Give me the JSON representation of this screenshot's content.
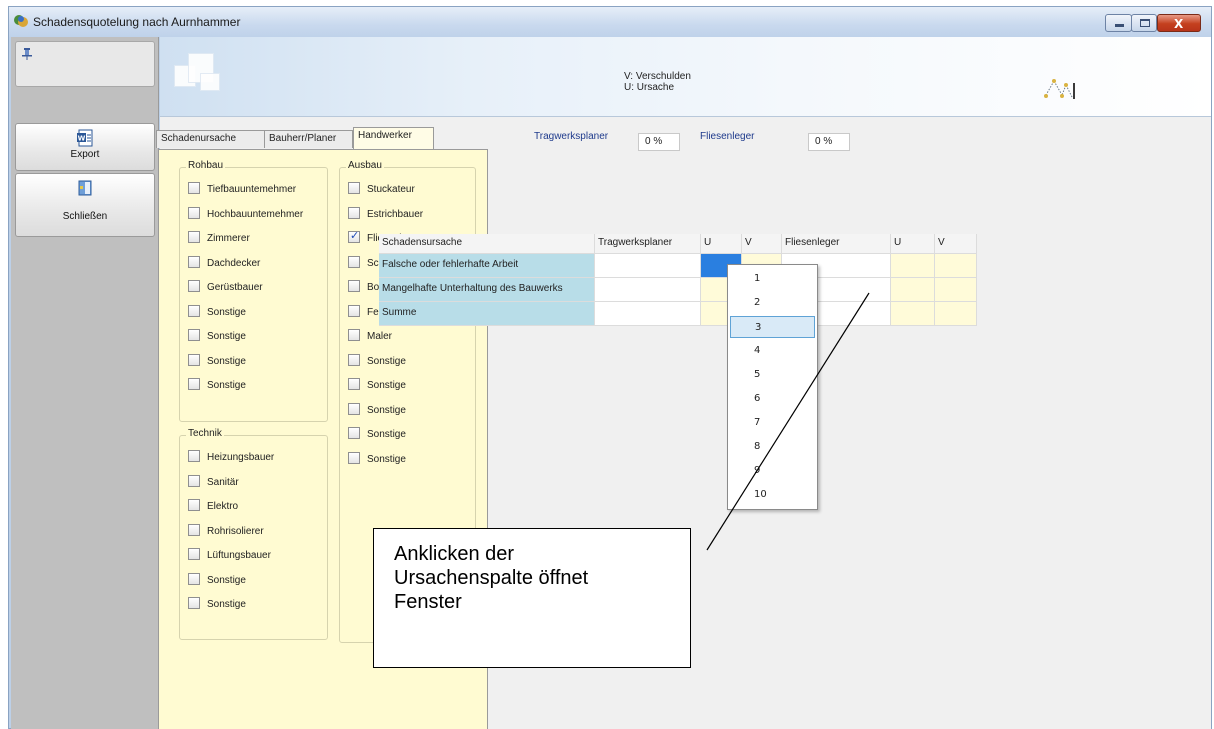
{
  "window": {
    "title": "Schadensquotelung nach Aurnhammer",
    "close_glyph": "X"
  },
  "sidebar": {
    "pin_icon": "pin-icon",
    "export_label": "Export",
    "close_label": "Schließen"
  },
  "banner": {
    "line1": "V: Verschulden",
    "line2": "U: Ursache"
  },
  "tabs": [
    {
      "label": "Schadenursache",
      "active": false
    },
    {
      "label": "Bauherr/Planer",
      "active": false
    },
    {
      "label": "Handwerker",
      "active": true
    }
  ],
  "groups": {
    "rohbau": {
      "title": "Rohbau",
      "items": [
        {
          "label": "Tiefbauuntemehmer",
          "checked": false
        },
        {
          "label": "Hochbauuntemehmer",
          "checked": false
        },
        {
          "label": "Zimmerer",
          "checked": false
        },
        {
          "label": "Dachdecker",
          "checked": false
        },
        {
          "label": "Gerüstbauer",
          "checked": false
        },
        {
          "label": "Sonstige",
          "checked": false
        },
        {
          "label": "Sonstige",
          "checked": false
        },
        {
          "label": "Sonstige",
          "checked": false
        },
        {
          "label": "Sonstige",
          "checked": false
        }
      ]
    },
    "ausbau": {
      "title": "Ausbau",
      "items": [
        {
          "label": "Stuckateur",
          "checked": false
        },
        {
          "label": "Estrichbauer",
          "checked": false
        },
        {
          "label": "Fliesenleger",
          "checked": true
        },
        {
          "label": "Schlosser",
          "checked": false
        },
        {
          "label": "Bodenleger",
          "checked": false
        },
        {
          "label": "Fensterbauer",
          "checked": false
        },
        {
          "label": "Maler",
          "checked": false
        },
        {
          "label": "Sonstige",
          "checked": false
        },
        {
          "label": "Sonstige",
          "checked": false
        },
        {
          "label": "Sonstige",
          "checked": false
        },
        {
          "label": "Sonstige",
          "checked": false
        },
        {
          "label": "Sonstige",
          "checked": false
        }
      ]
    },
    "technik": {
      "title": "Technik",
      "items": [
        {
          "label": "Heizungsbauer",
          "checked": false
        },
        {
          "label": "Sanitär",
          "checked": false
        },
        {
          "label": "Elektro",
          "checked": false
        },
        {
          "label": "Rohrisolierer",
          "checked": false
        },
        {
          "label": "Lüftungsbauer",
          "checked": false
        },
        {
          "label": "Sonstige",
          "checked": false
        },
        {
          "label": "Sonstige",
          "checked": false
        }
      ]
    }
  },
  "percentages": [
    {
      "label": "Tragwerksplaner",
      "value": "0 %"
    },
    {
      "label": "Fliesenleger",
      "value": "0 %"
    }
  ],
  "grid": {
    "headers": [
      "Schadensursache",
      "Tragwerksplaner",
      "U",
      "V",
      "Fliesenleger",
      "U",
      "V"
    ],
    "rows": [
      {
        "label": "Falsche oder fehlerhafte Arbeit"
      },
      {
        "label": "Mangelhafte Unterhaltung des Bauwerks"
      },
      {
        "label": "Summe"
      }
    ]
  },
  "dropdown": {
    "options": [
      "1",
      "2",
      "3",
      "4",
      "5",
      "6",
      "7",
      "8",
      "9",
      "10"
    ],
    "selected": "3"
  },
  "annotation": {
    "line1": "Anklicken der",
    "line2": "Ursachenspalte öffnet",
    "line3": "Fenster"
  },
  "colors": {
    "row_label_bg": "#b8dde8",
    "panel_bg": "#fffbd2",
    "accent_blue": "#1e3a8c",
    "selected_cell": "#2a7fe0"
  }
}
